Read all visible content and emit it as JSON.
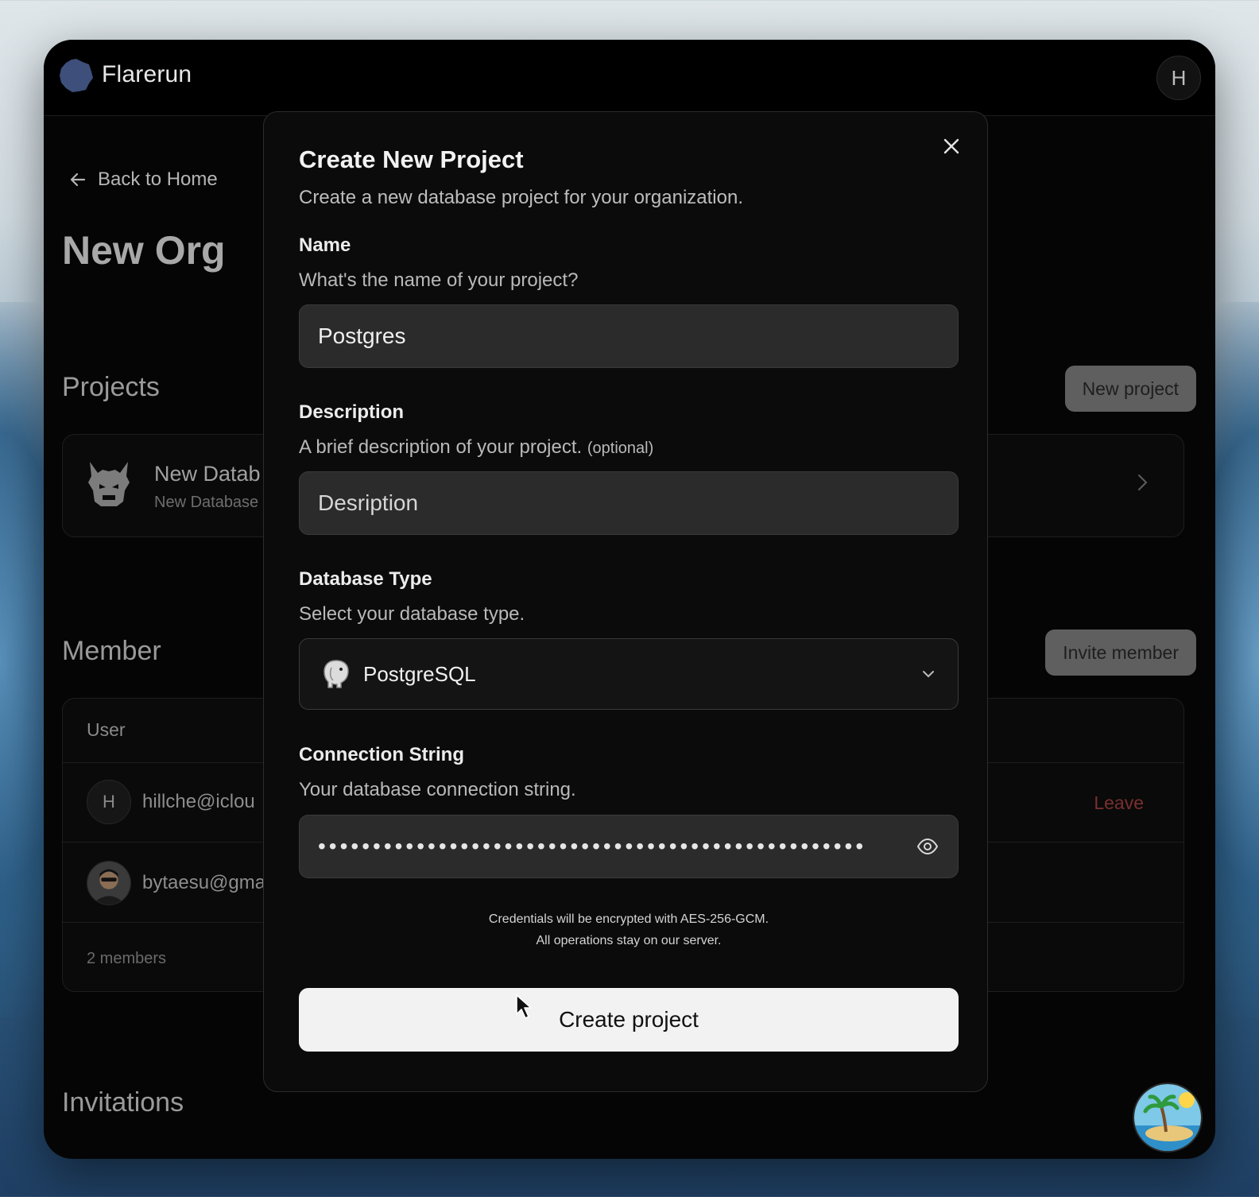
{
  "app": {
    "name": "Flarerun",
    "user_initial": "H"
  },
  "page": {
    "back_label": "Back to Home",
    "org_title": "New Org",
    "projects": {
      "title": "Projects",
      "new_button": "New project",
      "items": [
        {
          "name": "New Datab",
          "subtitle": "New Database"
        }
      ]
    },
    "members": {
      "title": "Member",
      "invite_button": "Invite member",
      "column_user": "User",
      "rows": [
        {
          "initial": "H",
          "email": "hillche@iclou",
          "action": "Leave"
        },
        {
          "initial": "",
          "email": "bytaesu@gma",
          "action": ""
        }
      ],
      "count": "2 members"
    },
    "invitations": {
      "title": "Invitations"
    }
  },
  "modal": {
    "title": "Create New Project",
    "subtitle": "Create a new database project for your organization.",
    "name": {
      "label": "Name",
      "help": "What's the name of your project?",
      "value": "Postgres"
    },
    "description": {
      "label": "Description",
      "help": "A brief description of your project.",
      "optional": "(optional)",
      "placeholder": "Desription"
    },
    "database_type": {
      "label": "Database Type",
      "help": "Select your database type.",
      "selected": "PostgreSQL",
      "icon": "postgresql-elephant-icon"
    },
    "connection_string": {
      "label": "Connection String",
      "help": "Your database connection string.",
      "masked": "••••••••••••••••••••••••••••••••••••••••••••••••••"
    },
    "note_line1": "Credentials will be encrypted with AES-256-GCM.",
    "note_line2": "All operations stay on our server.",
    "submit_label": "Create project"
  },
  "colors": {
    "background": "#050505",
    "modal": "#0b0b0b",
    "primary_button": "#f2f2f2",
    "danger_text": "#7a2f2f",
    "logo": "#3d4f7a"
  }
}
